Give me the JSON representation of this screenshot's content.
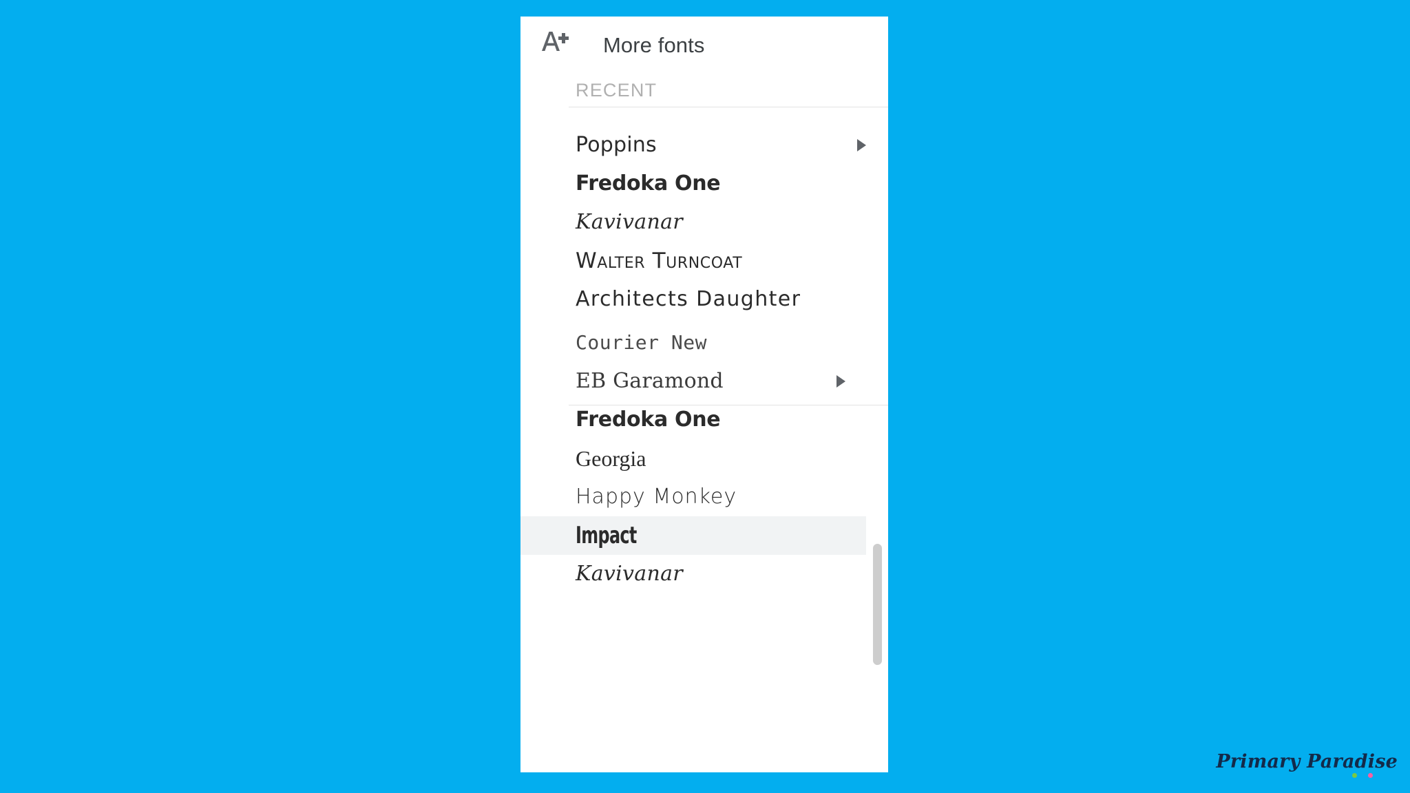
{
  "background_color": "#03aeef",
  "panel": {
    "background_color": "#ffffff",
    "header": {
      "icon": "add-font-icon",
      "icon_glyph": "A+",
      "label": "More fonts"
    },
    "section_label": "RECENT",
    "recent_fonts": [
      {
        "name": "Poppins",
        "style": "sans",
        "has_submenu": true,
        "selected": false
      },
      {
        "name": "Fredoka One",
        "style": "bold-round",
        "has_submenu": false,
        "selected": false
      },
      {
        "name": "Kavivanar",
        "style": "italic",
        "has_submenu": false,
        "selected": false
      },
      {
        "name": "Walter Turncoat",
        "style": "small-caps",
        "has_submenu": false,
        "selected": false
      },
      {
        "name": "Architects Daughter",
        "style": "handwrite",
        "has_submenu": false,
        "selected": false
      }
    ],
    "all_fonts": [
      {
        "name": "Courier New",
        "style": "mono",
        "has_submenu": false,
        "selected": false
      },
      {
        "name": "EB Garamond",
        "style": "serif",
        "has_submenu": true,
        "selected": false
      },
      {
        "name": "Fredoka One",
        "style": "bold-round",
        "has_submenu": false,
        "selected": false
      },
      {
        "name": "Georgia",
        "style": "serif",
        "has_submenu": false,
        "selected": false
      },
      {
        "name": "Happy Monkey",
        "style": "rounded",
        "has_submenu": false,
        "selected": false
      },
      {
        "name": "Impact",
        "style": "condensed",
        "has_submenu": false,
        "selected": true
      },
      {
        "name": "Kavivanar",
        "style": "italic",
        "has_submenu": false,
        "selected": false
      }
    ],
    "highlight_color": "#f1f3f4",
    "scrollbar": {
      "thumb_color": "#cdcdcd"
    }
  },
  "watermark": {
    "text": "Primary Paradise",
    "color": "#132a4a",
    "dots": [
      "#7ac943",
      "#ff5fa2"
    ]
  }
}
